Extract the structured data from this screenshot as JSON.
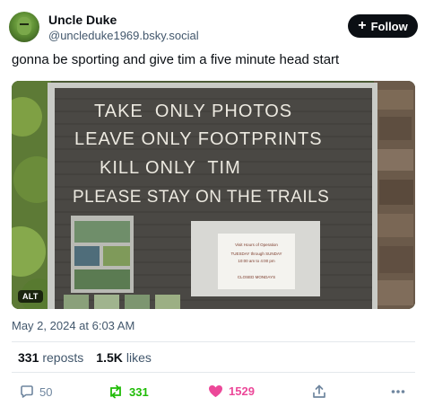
{
  "author": {
    "display_name": "Uncle Duke",
    "handle": "@uncleduke1969.bsky.social"
  },
  "follow_button": {
    "plus": "+",
    "label": "Follow"
  },
  "post": {
    "text": "gonna be sporting and give tim a five minute head start",
    "timestamp": "May 2, 2024 at 6:03 AM"
  },
  "image": {
    "alt_badge": "ALT",
    "sign_lines": [
      "TAKE  ONLY PHOTOS",
      "LEAVE ONLY FOOTPRINTS",
      "KILL ONLY  TIM",
      "PLEASE STAY ON THE TRAILS"
    ],
    "notice_lines": [
      "Visit Hours of Operation",
      "TUESDAY through SUNDAY",
      "10:00 am to 4:00 pm",
      "CLOSED MONDAYS"
    ]
  },
  "stats": {
    "reposts_count": "331",
    "reposts_label": "reposts",
    "likes_count": "1.5K",
    "likes_label": "likes"
  },
  "actions": {
    "reply_count": "50",
    "repost_count": "331",
    "like_count": "1529"
  },
  "colors": {
    "text": "#0b0f14",
    "muted": "#42576c",
    "repost": "#20bc07",
    "like": "#ec4899",
    "icon": "#6f869f"
  }
}
